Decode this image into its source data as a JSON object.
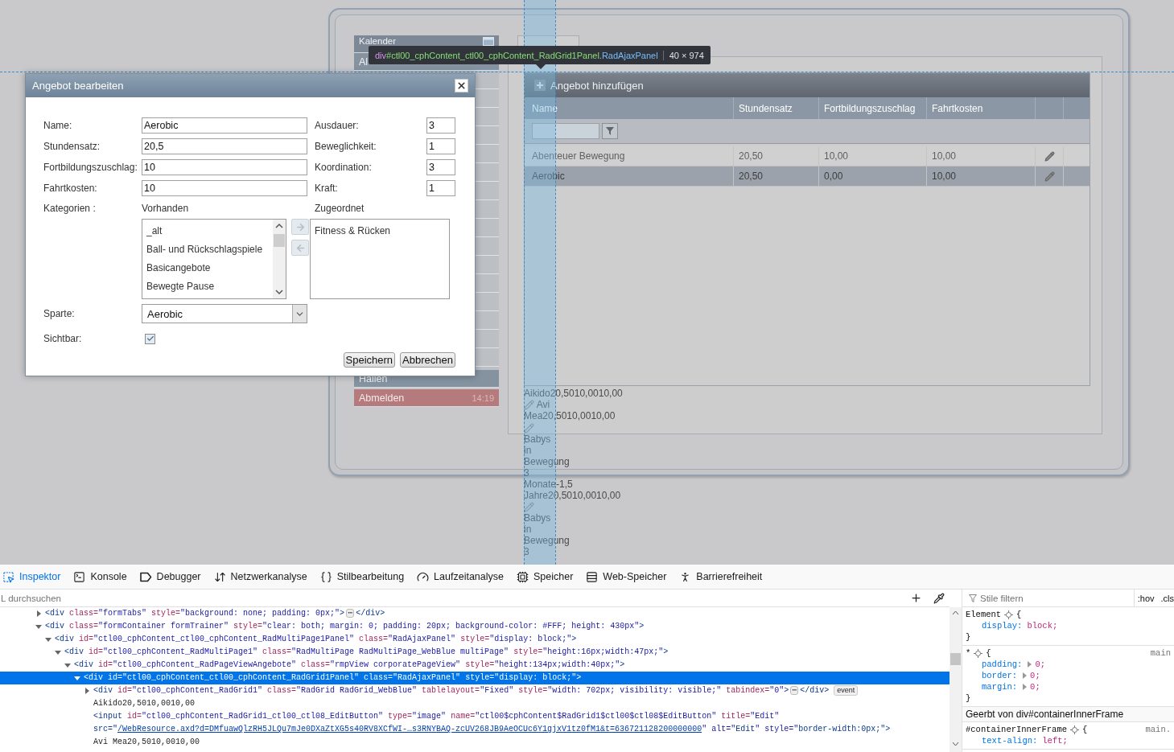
{
  "app": {
    "sidebar": [
      {
        "kind": "header",
        "label": "Kalender"
      },
      {
        "kind": "item",
        "label": "Al"
      },
      {
        "kind": "item",
        "label": "Hallen"
      },
      {
        "kind": "logout",
        "label": "Abmelden",
        "time": "14:19"
      }
    ],
    "grid": {
      "add_label": "Angebot hinzufügen",
      "columns": [
        "Name",
        "Stundensatz",
        "Fortbildungszuschlag",
        "Fahrtkosten"
      ],
      "rows": [
        {
          "name": "Abenteuer Bewegung",
          "rate": "20,50",
          "surcharge": "10,00",
          "travel": "10,00",
          "selected": false
        },
        {
          "name": "Aerobic",
          "rate": "20,50",
          "surcharge": "0,00",
          "travel": "10,00",
          "selected": true
        }
      ]
    },
    "overflow_entries": [
      {
        "kind": "text",
        "text": "Aikido20,5010,0010,00"
      },
      {
        "kind": "edit_icon"
      },
      {
        "kind": "text",
        "text": "Avi"
      },
      {
        "kind": "text",
        "text": "Mea20,5010,0010,00"
      },
      {
        "kind": "edit_icon"
      },
      {
        "kind": "text",
        "text": "Babys in Bewegung 3 Monate-1,5 Jahre20,5010,0010,00"
      },
      {
        "kind": "edit_icon"
      },
      {
        "kind": "text",
        "text": "Babys in Bewegung 3"
      }
    ]
  },
  "inspector_tooltip": {
    "tag": "div",
    "id": "#ctl00_cphContent_ctl00_cphContent_RadGrid1Panel",
    "class": ".RadAjaxPanel",
    "size": "40 × 974"
  },
  "dialog": {
    "title": "Angebot bearbeiten",
    "left_fields": [
      {
        "label": "Name:",
        "value": "Aerobic"
      },
      {
        "label": "Stundensatz:",
        "value": "20,5"
      },
      {
        "label": "Fortbildungszuschlag:",
        "value": "10"
      },
      {
        "label": "Fahrtkosten:",
        "value": "10"
      }
    ],
    "right_fields": [
      {
        "label": "Ausdauer:",
        "value": "3"
      },
      {
        "label": "Beweglichkeit:",
        "value": "1"
      },
      {
        "label": "Koordination:",
        "value": "3"
      },
      {
        "label": "Kraft:",
        "value": "1"
      }
    ],
    "categories": {
      "label": "Kategorien :",
      "available_label": "Vorhanden",
      "available": [
        "_alt",
        "Ball- und Rückschlagspiele",
        "Basicangebote",
        "Bewegte Pause"
      ],
      "assigned_label": "Zugeordnet",
      "assigned": [
        "Fitness & Rücken"
      ]
    },
    "division": {
      "label": "Sparte:",
      "value": "Aerobic"
    },
    "visible": {
      "label": "Sichtbar:",
      "checked": true
    },
    "buttons": [
      "Speichern",
      "Abbrechen"
    ]
  },
  "devtools": {
    "tabs": [
      {
        "label": "Inspektor",
        "selected": true
      },
      {
        "label": "Konsole",
        "selected": false
      },
      {
        "label": "Debugger",
        "selected": false
      },
      {
        "label": "Netzwerkanalyse",
        "selected": false
      },
      {
        "label": "Stilbearbeitung",
        "selected": false
      },
      {
        "label": "Laufzeitanalyse",
        "selected": false
      },
      {
        "label": "Speicher",
        "selected": false
      },
      {
        "label": "Web-Speicher",
        "selected": false
      },
      {
        "label": "Barrierefreiheit",
        "selected": false
      }
    ],
    "search_placeholder": "L durchsuchen",
    "markup": [
      {
        "expanded": false,
        "selected": false,
        "segments": [
          {
            "kind": "code",
            "text": "<div class=\"formTabs\" style=\"background: none; padding: 0px;\">"
          },
          {
            "kind": "marker",
            "text": "⋯"
          },
          {
            "kind": "code",
            "text": "</div>"
          }
        ]
      },
      {
        "expanded": true,
        "selected": false,
        "segments": [
          {
            "kind": "code",
            "text": "<div class=\"formContainer formTrainer\" style=\"clear: both; margin: 0; padding: 20px; background-color: #FFF; height: 430px\">"
          }
        ],
        "children": [
          {
            "expanded": true,
            "selected": false,
            "segments": [
              {
                "kind": "code",
                "text": "<div id=\"ctl00_cphContent_ctl00_cphContent_RadMultiPage1Panel\" class=\"RadAjaxPanel\" style=\"display: block;\">"
              }
            ],
            "children": [
              {
                "expanded": true,
                "selected": false,
                "segments": [
                  {
                    "kind": "code",
                    "text": "<div id=\"ctl00_cphContent_RadMultiPage1\" class=\"RadMultiPage RadMultiPage_WebBlue multiPage\" style=\"height:16px;width:47px;\">"
                  }
                ],
                "children": [
                  {
                    "expanded": true,
                    "selected": false,
                    "segments": [
                      {
                        "kind": "code",
                        "text": "<div id=\"ctl00_cphContent_RadPageViewAngebote\" class=\"rmpView corporatePageView\" style=\"height:134px;width:40px;\">"
                      }
                    ],
                    "children": [
                      {
                        "expanded": true,
                        "selected": true,
                        "segments": [
                          {
                            "kind": "code",
                            "text": "<div id=\"ctl00_cphContent_ctl00_cphContent_RadGrid1Panel\" class=\"RadAjaxPanel\" style=\"display: block;\">"
                          }
                        ],
                        "children": [
                          {
                            "expanded": false,
                            "selected": false,
                            "segments": [
                              {
                                "kind": "code",
                                "text": "<div id=\"ctl00_cphContent_RadGrid1\" class=\"RadGrid RadGrid_WebBlue\" tablelayout=\"Fixed\" style=\"width: 702px; visibility: visible;\" tabindex=\"0\">"
                              },
                              {
                                "kind": "marker",
                                "text": "⋯"
                              },
                              {
                                "kind": "code",
                                "text": "</div>"
                              },
                              {
                                "kind": "badge",
                                "text": "event"
                              }
                            ]
                          },
                          {
                            "selected": false,
                            "segments": [
                              {
                                "kind": "text",
                                "text": "Aikido20,5010,0010,00"
                              }
                            ]
                          },
                          {
                            "selected": false,
                            "segments": [
                              {
                                "kind": "code",
                                "text": "<input id=\"ctl00_cphContent_RadGrid1_ctl00_ctl08_EditButton\" type=\"image\" name=\"ctl00$cphContent$RadGrid1$ctl00$ctl08$EditButton\" title=\"Edit\" "
                              },
                              {
                                "kind": "code",
                                "text": "src=\""
                              },
                              {
                                "kind": "link",
                                "text": "/WebResource.axd?d=DMfuawQlzRH5JLQu7mJe0DXaZtXG5s40RV8XCfWI-…s3RNYBAQ-zcUV268JB9AeOCUc6Y1gjxV1tz0fM1&t=636721128200000000"
                              },
                              {
                                "kind": "code",
                                "text": "\" alt=\"Edit\" style=\"border-width:0px;\">"
                              }
                            ]
                          },
                          {
                            "selected": false,
                            "segments": [
                              {
                                "kind": "text",
                                "text": "Avi Mea20,5010,0010,00"
                              }
                            ]
                          }
                        ]
                      }
                    ]
                  }
                ]
              }
            ]
          }
        ]
      }
    ],
    "styles": {
      "filter_placeholder": "Stile filtern",
      "toggles": [
        ":hov",
        ".cls"
      ],
      "blocks": [
        {
          "kind": "rule",
          "selector": "Element",
          "open_brace": "{",
          "close_brace": "}",
          "decls": [
            {
              "property": "display:",
              "value": "block;",
              "expandable": false
            }
          ]
        },
        {
          "kind": "rule",
          "selector": "*",
          "source": "main",
          "open_brace": "{",
          "close_brace": "}",
          "decls": [
            {
              "property": "padding:",
              "value": "0;",
              "expandable": true
            },
            {
              "property": "border:",
              "value": "0;",
              "expandable": true
            },
            {
              "property": "margin:",
              "value": "0;",
              "expandable": true
            }
          ]
        },
        {
          "kind": "heading",
          "text": "Geerbt von div#containerInnerFrame"
        },
        {
          "kind": "rule",
          "selector": "#containerInnerFrame",
          "source": "main.",
          "open_brace": "{",
          "decls": [
            {
              "property": "text-align:",
              "value": "left;",
              "expandable": false
            }
          ]
        }
      ]
    }
  }
}
